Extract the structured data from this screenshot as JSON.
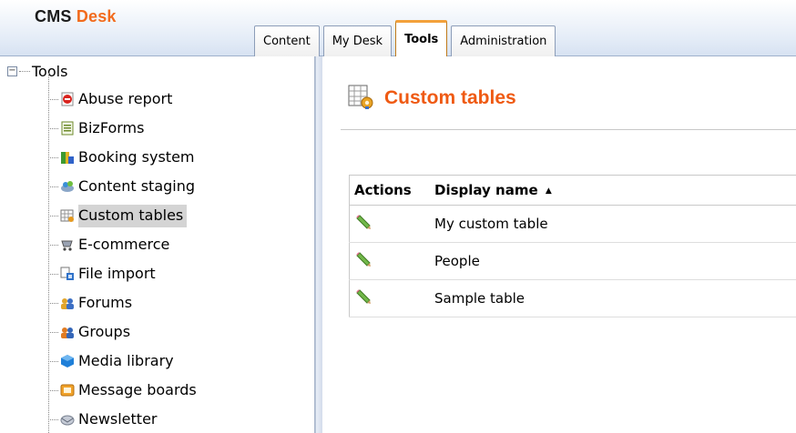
{
  "app": {
    "logo_primary": "CMS",
    "logo_secondary": "Desk"
  },
  "tabs": [
    {
      "label": "Content",
      "active": false
    },
    {
      "label": "My Desk",
      "active": false
    },
    {
      "label": "Tools",
      "active": true
    },
    {
      "label": "Administration",
      "active": false
    }
  ],
  "tree": {
    "root_label": "Tools",
    "expander": "−",
    "items": [
      {
        "label": "Abuse report",
        "icon": "abuse-report-icon"
      },
      {
        "label": "BizForms",
        "icon": "bizforms-icon"
      },
      {
        "label": "Booking system",
        "icon": "booking-system-icon"
      },
      {
        "label": "Content staging",
        "icon": "content-staging-icon"
      },
      {
        "label": "Custom tables",
        "icon": "custom-tables-icon",
        "selected": true
      },
      {
        "label": "E-commerce",
        "icon": "e-commerce-icon"
      },
      {
        "label": "File import",
        "icon": "file-import-icon"
      },
      {
        "label": "Forums",
        "icon": "forums-icon"
      },
      {
        "label": "Groups",
        "icon": "groups-icon"
      },
      {
        "label": "Media library",
        "icon": "media-library-icon"
      },
      {
        "label": "Message boards",
        "icon": "message-boards-icon"
      },
      {
        "label": "Newsletter",
        "icon": "newsletter-icon"
      }
    ]
  },
  "main": {
    "title": "Custom tables",
    "title_icon": "custom-tables-icon",
    "grid": {
      "columns": [
        "Actions",
        "Display name"
      ],
      "sort_indicator": "▲",
      "rows": [
        {
          "name": "My custom table",
          "action_icon": "edit-pencil-icon"
        },
        {
          "name": "People",
          "action_icon": "edit-pencil-icon"
        },
        {
          "name": "Sample table",
          "action_icon": "edit-pencil-icon"
        }
      ]
    }
  },
  "colors": {
    "accent": "#ef5a13",
    "active_tab_border": "#f3a13b",
    "selection": "#d4d4d4"
  }
}
